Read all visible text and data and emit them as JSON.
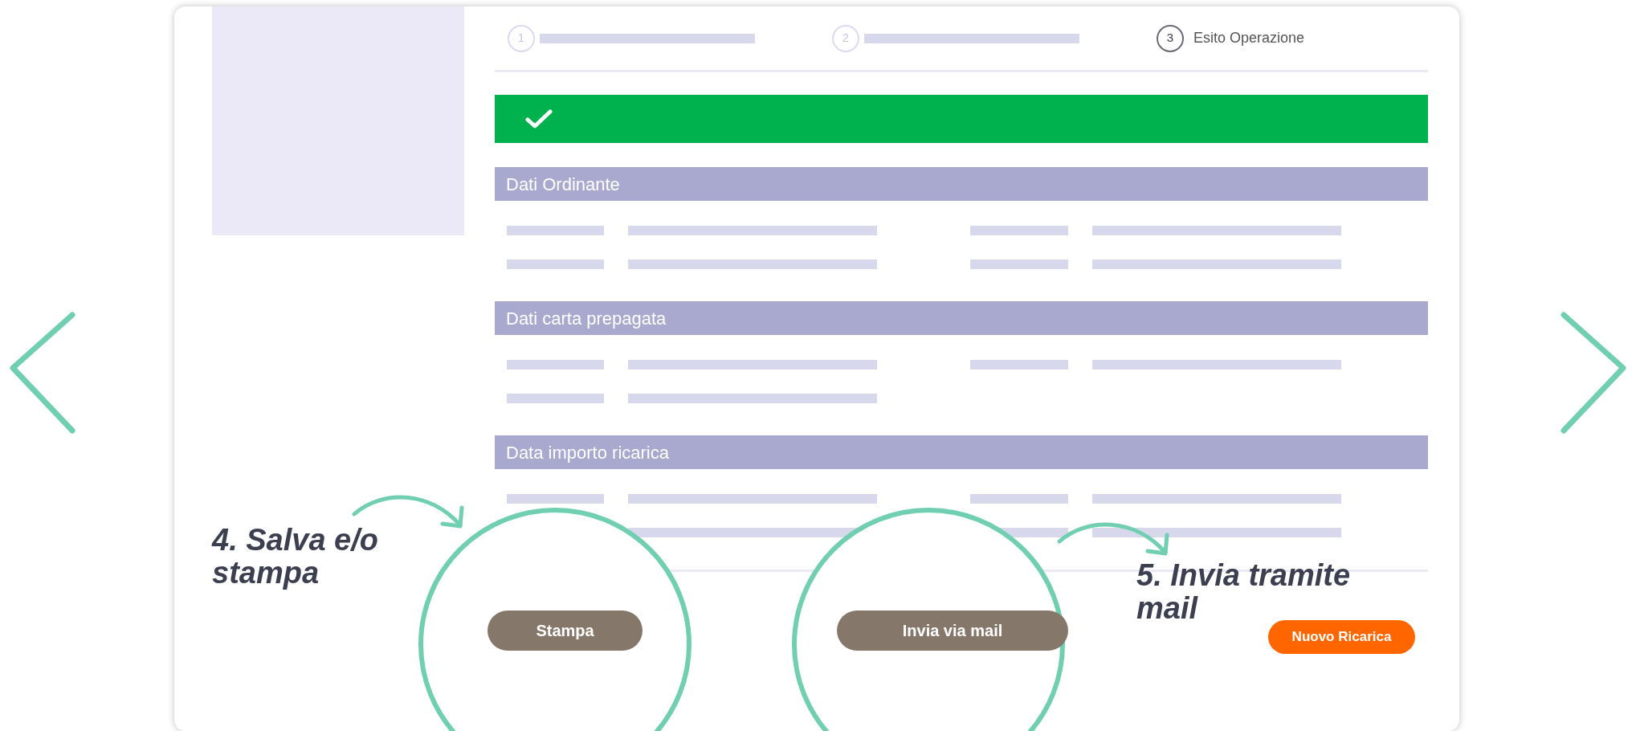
{
  "steps": [
    {
      "number": "1",
      "current": false
    },
    {
      "number": "2",
      "current": false
    },
    {
      "number": "3",
      "label": "Esito Operazione",
      "current": true
    }
  ],
  "banner": {
    "kind": "success"
  },
  "sections": [
    {
      "title": "Dati Ordinante",
      "rows": [
        {
          "kind": "full"
        },
        {
          "kind": "full"
        }
      ]
    },
    {
      "title": "Dati carta prepagata",
      "rows": [
        {
          "kind": "full"
        },
        {
          "kind": "half"
        }
      ]
    },
    {
      "title": "Data importo ricarica",
      "rows": [
        {
          "kind": "full"
        },
        {
          "kind": "partial"
        }
      ]
    }
  ],
  "buttons": [
    {
      "label": "Stampa",
      "kind": "secondary"
    },
    {
      "label": "Invia via mail",
      "kind": "secondary"
    },
    {
      "label": "Nuovo Ricarica",
      "kind": "primary"
    }
  ],
  "annotations": [
    {
      "text": "4. Salva e/o stampa"
    },
    {
      "text": "5. Invia tramite mail"
    }
  ]
}
